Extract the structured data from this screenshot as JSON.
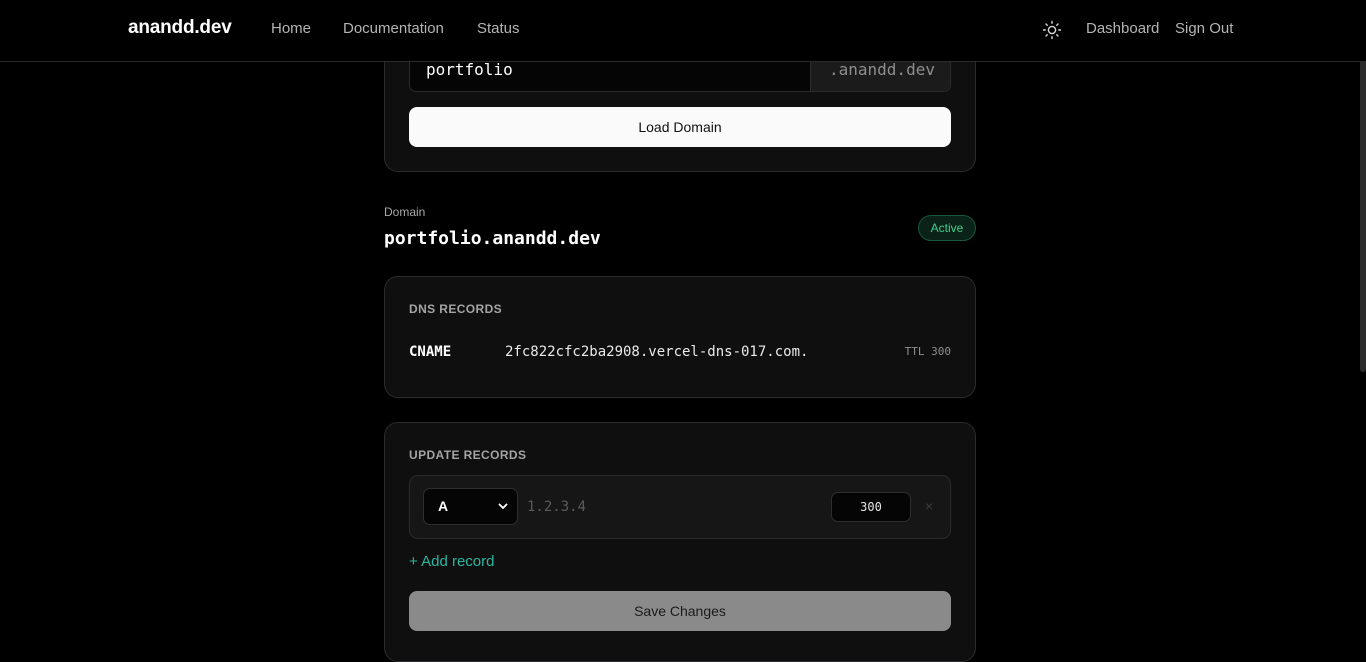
{
  "header": {
    "brand": "anandd.dev",
    "nav": {
      "home": "Home",
      "documentation": "Documentation",
      "status": "Status"
    },
    "theme_icon": "sun-icon",
    "dashboard": "Dashboard",
    "sign_out": "Sign Out"
  },
  "search": {
    "subdomain_value": "portfolio",
    "suffix": ".anandd.dev",
    "load_button": "Load Domain"
  },
  "domain": {
    "label": "Domain",
    "name": "portfolio.anandd.dev",
    "status": "Active"
  },
  "dns_records": {
    "title": "DNS RECORDS",
    "records": [
      {
        "type": "CNAME",
        "value": "2fc822cfc2ba2908.vercel-dns-017.com.",
        "ttl": "TTL 300"
      }
    ]
  },
  "update_records": {
    "title": "UPDATE RECORDS",
    "row": {
      "type": "A",
      "value_placeholder": "1.2.3.4",
      "ttl": "300",
      "remove": "×"
    },
    "add_record": "+ Add record",
    "save_button": "Save Changes"
  },
  "colors": {
    "background": "#000000",
    "card": "#0f0f10",
    "accent_teal": "#2ab7a0",
    "active_green": "#3ecf8e"
  }
}
